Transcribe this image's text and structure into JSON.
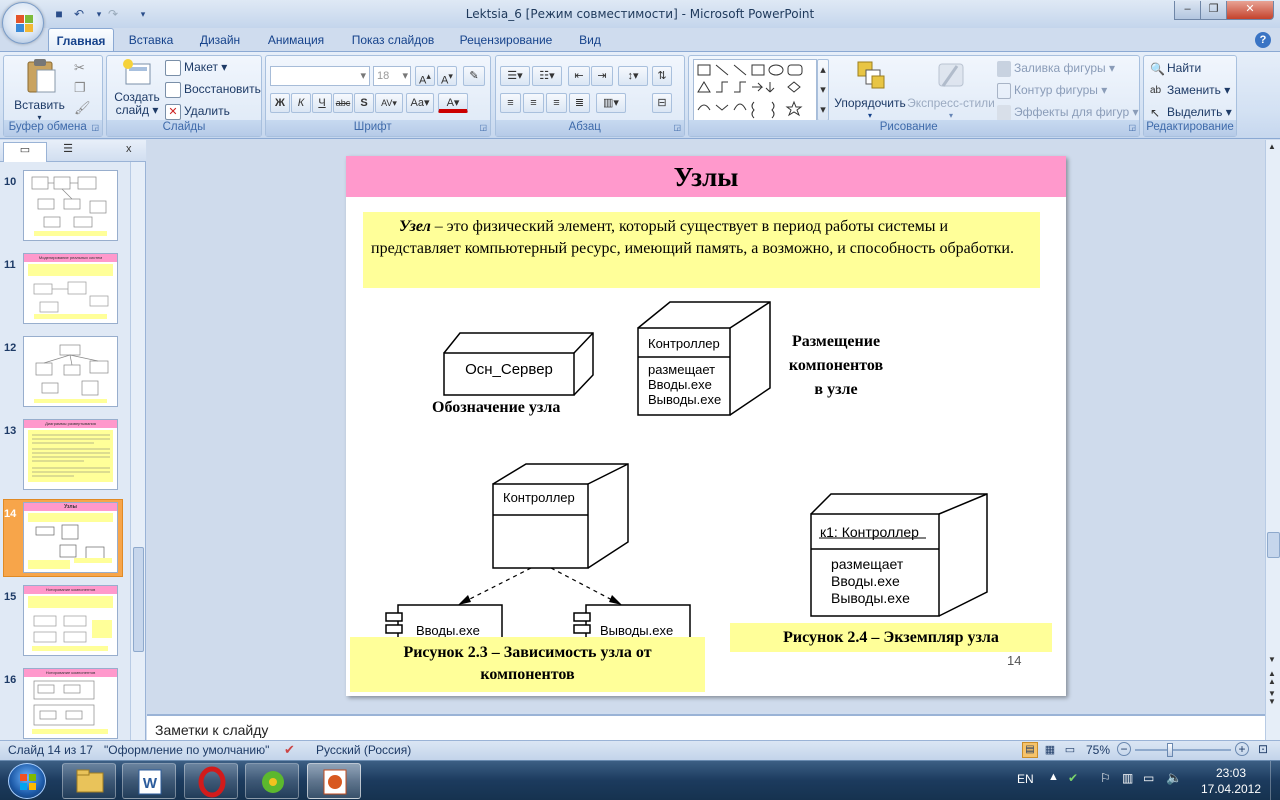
{
  "window": {
    "title": "Lektsia_6 [Режим совместимости] - Microsoft PowerPoint"
  },
  "tabs": [
    "Главная",
    "Вставка",
    "Дизайн",
    "Анимация",
    "Показ слайдов",
    "Рецензирование",
    "Вид"
  ],
  "ribbon": {
    "clipboard": {
      "label": "Буфер обмена",
      "paste": "Вставить"
    },
    "slides": {
      "label": "Слайды",
      "create_line1": "Создать",
      "create_line2": "слайд",
      "layout": "Макет",
      "reset": "Восстановить",
      "delete": "Удалить"
    },
    "font": {
      "label": "Шрифт",
      "size": "18"
    },
    "paragraph": {
      "label": "Абзац"
    },
    "drawing": {
      "label": "Рисование",
      "arrange": "Упорядочить",
      "quick_styles": "Экспресс-стили",
      "fill": "Заливка фигуры",
      "outline": "Контур фигуры",
      "effects": "Эффекты для фигур"
    },
    "editing": {
      "label": "Редактирование",
      "find": "Найти",
      "replace": "Заменить",
      "select": "Выделить"
    }
  },
  "thumbnails": [
    {
      "num": "10",
      "title": ""
    },
    {
      "num": "11",
      "title": "Моделирование реальных систем"
    },
    {
      "num": "12",
      "title": ""
    },
    {
      "num": "13",
      "title": "Диаграммы развертывания"
    },
    {
      "num": "14",
      "title": "Узлы",
      "selected": true
    },
    {
      "num": "15",
      "title": "Нотирование компонентов"
    },
    {
      "num": "16",
      "title": "Нотирование компонентов"
    }
  ],
  "slide": {
    "title": "Узлы",
    "def_term": "Узел",
    "def_text": " – это физический элемент, который существует в период работы системы и представляет компьютерный ресурс, имеющий память, а возможно, и способность обработки.",
    "node1_name": "Осн_Сервер",
    "node1_caption": "Обозначение узла",
    "node2_name": "Контроллер",
    "node2_lines": [
      "размещает",
      "Вводы.exe",
      "Выводы.exe"
    ],
    "placement_caption": [
      "Размещение",
      "компонентов",
      "в узле"
    ],
    "fig3_node": "Контроллер",
    "fig3_comp1": "Вводы.exe",
    "fig3_comp2": "Выводы.exe",
    "fig3_caption": "Рисунок 2.3 – Зависимость узла от компонентов",
    "fig4_node": "к1: Контроллер",
    "fig4_lines": [
      "размещает",
      "Вводы.exe",
      "Выводы.exe"
    ],
    "fig4_caption": "Рисунок 2.4 – Экземпляр узла",
    "page_num": "14"
  },
  "notes": {
    "placeholder": "Заметки к слайду"
  },
  "status": {
    "slide": "Слайд 14 из 17",
    "theme": "\"Оформление по умолчанию\"",
    "lang": "Русский (Россия)",
    "zoom": "75%",
    "zoom_level": 0.75
  },
  "taskbar": {
    "lang": "EN",
    "time": "23:03",
    "date": "17.04.2012"
  },
  "colors": {
    "slide_title_bg": "#ff99cc",
    "text_box_bg": "#ffff99",
    "accent_selected": "#f7a54a"
  }
}
